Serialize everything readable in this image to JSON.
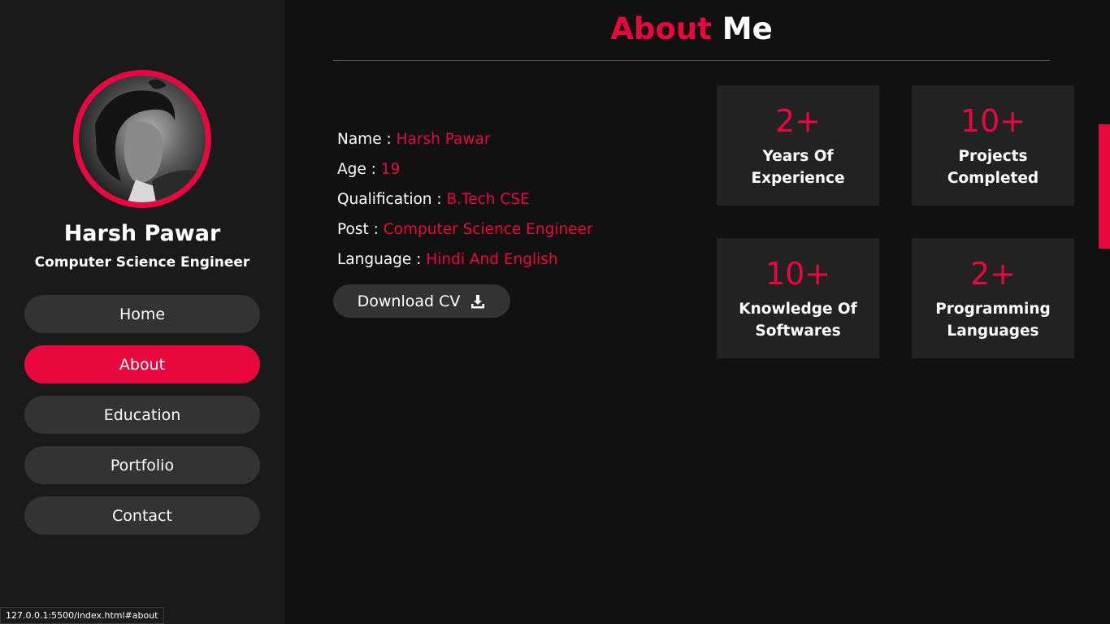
{
  "profile": {
    "name": "Harsh Pawar",
    "role": "Computer Science Engineer"
  },
  "nav": {
    "items": [
      {
        "label": "Home",
        "active": false
      },
      {
        "label": "About",
        "active": true
      },
      {
        "label": "Education",
        "active": false
      },
      {
        "label": "Portfolio",
        "active": false
      },
      {
        "label": "Contact",
        "active": false
      }
    ]
  },
  "section": {
    "title_accent": "About",
    "title_rest": "Me"
  },
  "info": [
    {
      "label": "Name :",
      "value": "Harsh Pawar"
    },
    {
      "label": "Age :",
      "value": "19"
    },
    {
      "label": "Qualification :",
      "value": "B.Tech CSE"
    },
    {
      "label": "Post :",
      "value": "Computer Science Engineer"
    },
    {
      "label": "Language :",
      "value": "Hindi And English"
    }
  ],
  "download": {
    "label": "Download CV",
    "icon": "download-icon"
  },
  "stats": [
    {
      "number": "2+",
      "line1": "Years Of",
      "line2": "Experience"
    },
    {
      "number": "10+",
      "line1": "Projects",
      "line2": "Completed"
    },
    {
      "number": "10+",
      "line1": "Knowledge Of",
      "line2": "Softwares"
    },
    {
      "number": "2+",
      "line1": "Programming",
      "line2": "Languages"
    }
  ],
  "status_bar": {
    "url": "127.0.0.1:5500/index.html#about"
  },
  "colors": {
    "accent": "#e8083e",
    "background": "#111111",
    "sidebar": "#1a1a1a",
    "button": "#333333",
    "card": "#222222"
  }
}
